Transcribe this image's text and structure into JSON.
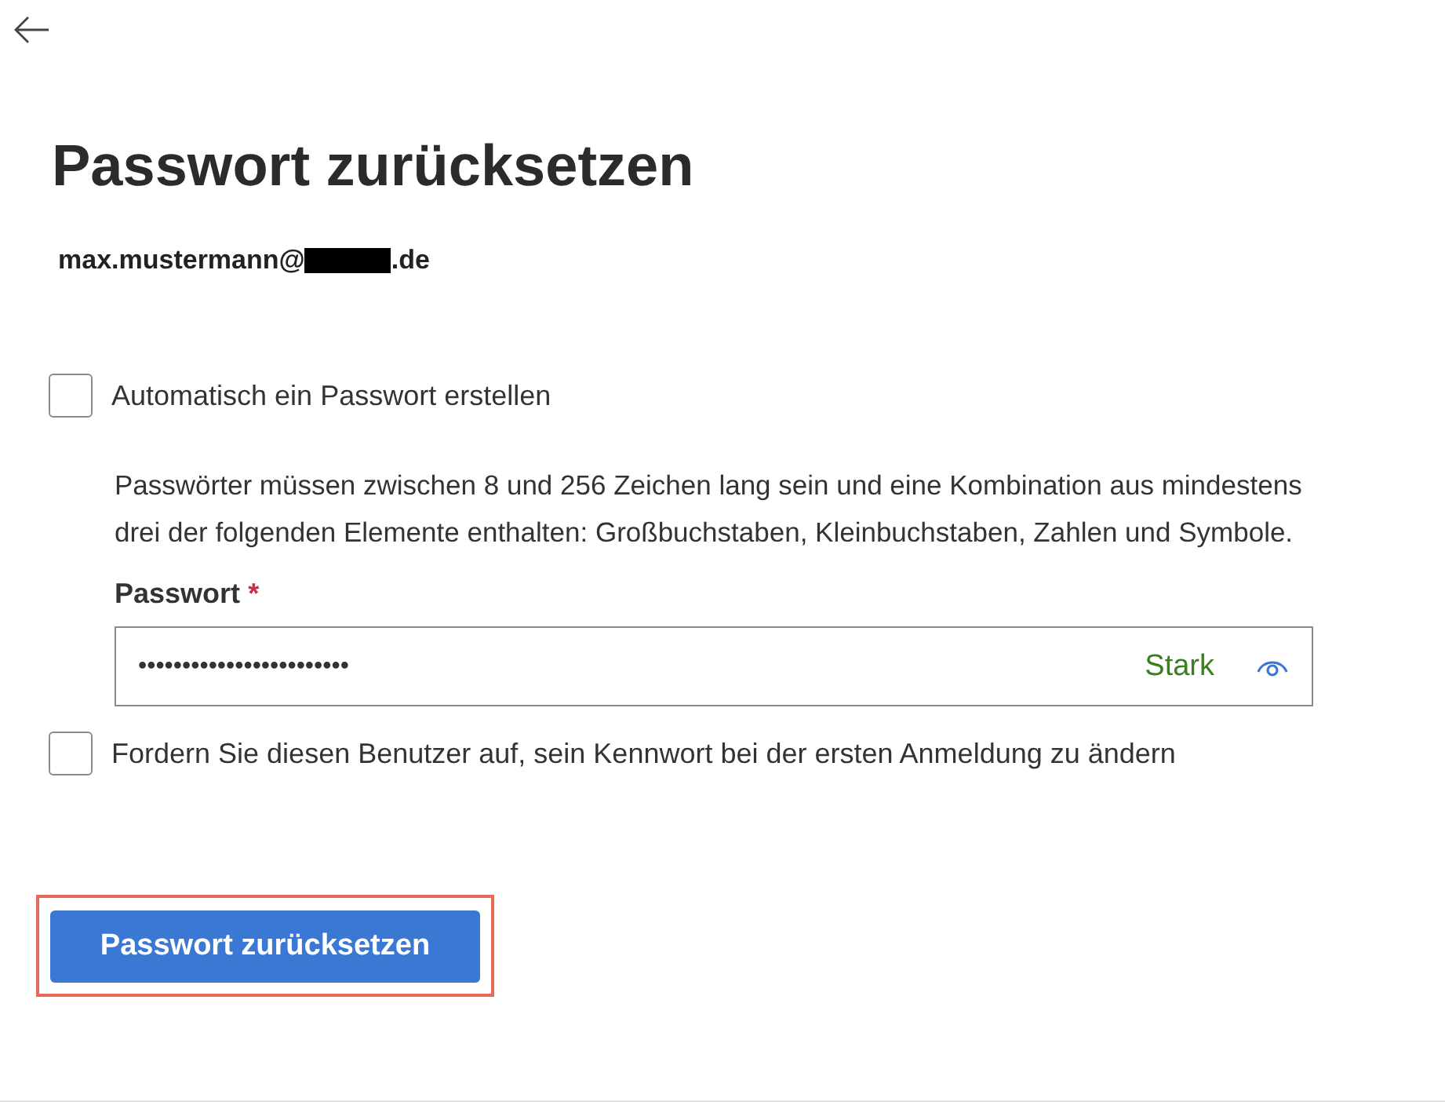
{
  "title": "Passwort zurücksetzen",
  "account": {
    "email_start": "max.mustermann@",
    "email_end": ".de",
    "redacted": true
  },
  "auto_password": {
    "label": "Automatisch ein Passwort erstellen",
    "checked": false
  },
  "hint": "Passwörter müssen zwischen 8 und 256 Zeichen lang sein und eine Kombination aus mindestens drei der folgenden Elemente enthalten: Großbuchstaben, Kleinbuchstaben, Zahlen und Symbole.",
  "password": {
    "label": "Passwort",
    "required_mark": "*",
    "value": "••••••••••••••••••••••••",
    "strength": "Stark"
  },
  "force_change": {
    "label": "Fordern Sie diesen Benutzer auf, sein Kennwort bei der ersten Anmeldung zu ändern",
    "checked": false
  },
  "submit": {
    "label": "Passwort zurücksetzen",
    "highlighted": true
  }
}
